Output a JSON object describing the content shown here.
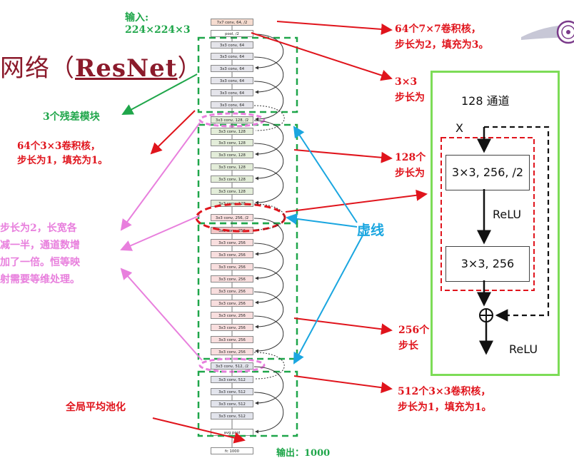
{
  "title": {
    "prefix": "网络（",
    "name": "ResNet",
    "suffix": "）"
  },
  "input_label": "输入:",
  "input_size": "224×224×3",
  "output_label": "输出：1000",
  "labels": {
    "conv7": [
      "64个7×7卷积核，",
      "步长为2，填充为3。"
    ],
    "conv_partial_top": [
      "3×3",
      "步长为"
    ],
    "three_blocks": "3个残差模块",
    "conv64": [
      "64个3×3卷积核，",
      "步长为1，填充为1。"
    ],
    "conv128_partial": [
      "128个",
      "步长为"
    ],
    "downsample": [
      "步长为2，长宽各",
      "减一半，通道数增",
      "加了一倍。恒等映",
      "射需要等维处理。"
    ],
    "dashed": "虚线",
    "conv256_partial": [
      "256个",
      "步长"
    ],
    "conv512": [
      "512个3×3卷积核，",
      "步长为1，填充为1。"
    ],
    "gap": "全局平均池化"
  },
  "layers": [
    "7x7 conv, 64, /2",
    "pool, /2",
    "3x3 conv, 64",
    "3x3 conv, 64",
    "3x3 conv, 64",
    "3x3 conv, 64",
    "3x3 conv, 64",
    "3x3 conv, 64",
    "3x3 conv, 128, /2",
    "3x3 conv, 128",
    "3x3 conv, 128",
    "3x3 conv, 128",
    "3x3 conv, 128",
    "3x3 conv, 128",
    "3x3 conv, 128",
    "3x3 conv, 128",
    "3x3 conv, 256, /2",
    "3x3 conv, 256",
    "3x3 conv, 256",
    "3x3 conv, 256",
    "3x3 conv, 256",
    "3x3 conv, 256",
    "3x3 conv, 256",
    "3x3 conv, 256",
    "3x3 conv, 256",
    "3x3 conv, 256",
    "3x3 conv, 256",
    "3x3 conv, 256",
    "3x3 conv, 512, /2",
    "3x3 conv, 512",
    "3x3 conv, 512",
    "3x3 conv, 512",
    "3x3 conv, 512",
    "avg pool",
    "fc 1000"
  ],
  "inset": {
    "channels": "128 通道",
    "x_label": "X",
    "block1": "3×3, 256, /2",
    "relu1": "ReLU",
    "block2": "3×3, 256",
    "relu2": "ReLU"
  },
  "colors": {
    "title": "#8b1a2b",
    "red": "#e0141c",
    "green": "#1fa64a",
    "pink": "#e87fdd",
    "cyan": "#1aa6e0",
    "inset_border": "#7ddc57"
  },
  "icons": [
    "university-seal-icon"
  ]
}
